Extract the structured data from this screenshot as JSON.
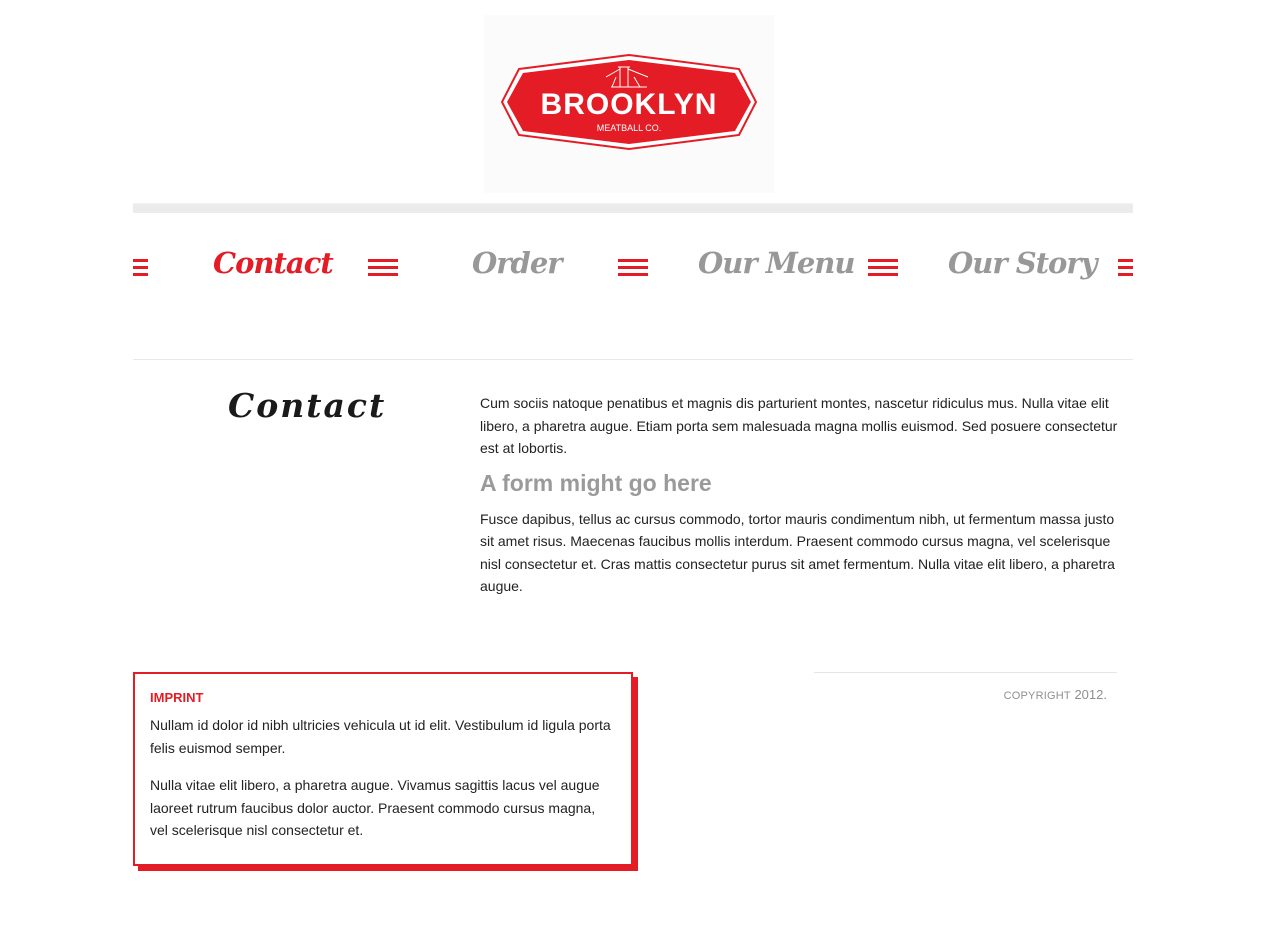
{
  "logo": {
    "name": "BROOKLYN",
    "tagline": "MEATBALL CO.",
    "brand_color": "#e31c25",
    "icon": "brooklyn-bridge-icon"
  },
  "nav": {
    "items": [
      {
        "label": "Contact",
        "active": true
      },
      {
        "label": "Order",
        "active": false
      },
      {
        "label": "Our Menu",
        "active": false
      },
      {
        "label": "Our Story",
        "active": false
      }
    ],
    "separator_icon": "hamburger-lines-icon",
    "active_color": "#e31c25",
    "inactive_color": "#989898"
  },
  "main": {
    "heading": "Contact",
    "intro": "Cum sociis natoque penatibus et magnis dis parturient montes, nascetur ridiculus mus. Nulla vitae elit libero, a pharetra augue. Etiam porta sem malesuada magna mollis euismod. Sed posuere consectetur est at lobortis.",
    "subheading": "A form might go here",
    "body": "Fusce dapibus, tellus ac cursus commodo, tortor mauris condimentum nibh, ut fermentum massa justo sit amet risus. Maecenas faucibus mollis interdum. Praesent commodo cursus magna, vel scelerisque nisl consectetur et. Cras mattis consectetur purus sit amet fermentum. Nulla vitae elit libero, a pharetra augue."
  },
  "imprint": {
    "title": "IMPRINT",
    "paragraph_1": "Nullam id dolor id nibh ultricies vehicula ut id elit. Vestibulum id ligula porta felis euismod semper.",
    "paragraph_2": "Nulla vitae elit libero, a pharetra augue. Vivamus sagittis lacus vel augue laoreet rutrum faucibus dolor auctor. Praesent commodo cursus magna, vel scelerisque nisl consectetur et."
  },
  "footer": {
    "copyright_label": "COPYRIGHT",
    "copyright_year": "2012."
  }
}
